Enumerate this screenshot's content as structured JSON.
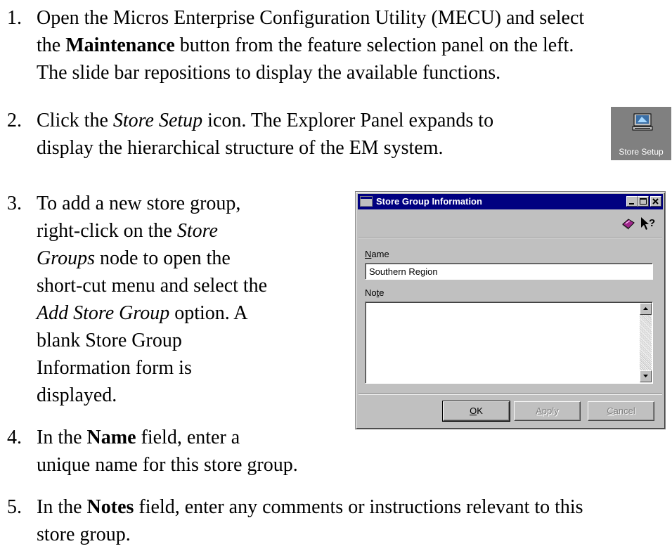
{
  "steps": [
    {
      "number": "1.",
      "lines": [
        "Open the Micros Enterprise Configuration Utility (MECU) and select",
        "the ",
        "Maintenance",
        " button from the feature selection panel on the left.",
        "The slide bar repositions to display the available functions."
      ]
    },
    {
      "number": "2.",
      "part1": "Click the ",
      "em": "Store Setup",
      "part2": " icon.  The Explorer Panel expands to",
      "line2": "display the hierarchical structure of the EM system."
    },
    {
      "number": "3.",
      "l1": "To add a new store group,",
      "l2a": "right-click on the ",
      "l2b": "Store",
      "l3a": "Groups",
      "l3b": " node to open the",
      "l4": "short-cut menu and select the",
      "l5a": "Add Store Group",
      "l5b": " option. A",
      "l6": "blank Store Group",
      "l7": "Information form is",
      "l8": "displayed."
    },
    {
      "number": "4.",
      "l1a": "In the ",
      "l1b": "Name",
      "l1c": " field, enter a",
      "l2": "unique name for this store group."
    },
    {
      "number": "5.",
      "l1a": "In the ",
      "l1b": "Notes",
      "l1c": " field, enter any comments or instructions relevant to this",
      "l2": "store group."
    }
  ],
  "store_setup_icon": {
    "label": "Store Setup",
    "icon": "computer-monitor-icon"
  },
  "dialog": {
    "title": "Store Group Information",
    "toolbar_icons": [
      "book-icon",
      "help-pointer-icon"
    ],
    "name_label_ul": "N",
    "name_label_rest": "ame",
    "name_value": "Southern Region",
    "note_label_a": "No",
    "note_label_ul": "t",
    "note_label_b": "e",
    "note_value": "",
    "buttons": {
      "ok_ul": "O",
      "ok_rest": "K",
      "apply_ul": "A",
      "apply_rest": "pply",
      "cancel_ul": "C",
      "cancel_rest": "ancel"
    },
    "colors": {
      "titlebar": "#000080",
      "face": "#c0c0c0"
    }
  }
}
